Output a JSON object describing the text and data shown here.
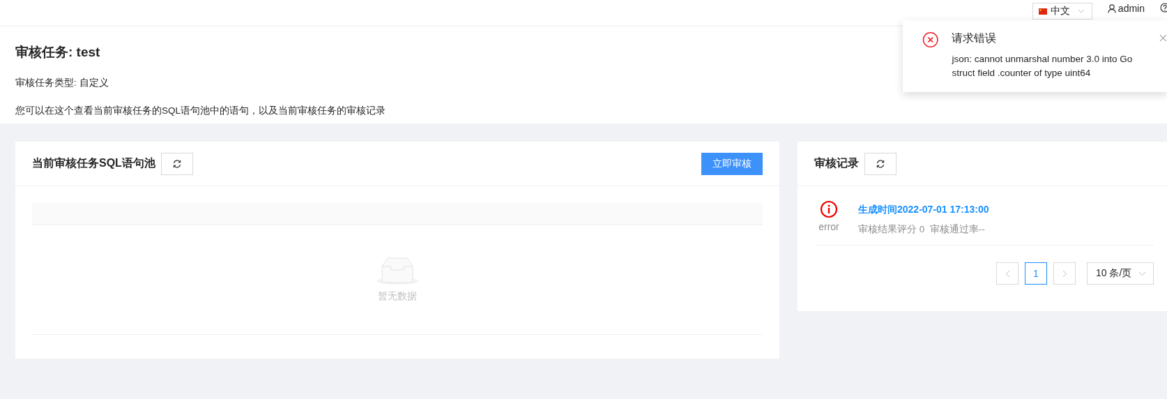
{
  "topbar": {
    "language": "中文",
    "user": "admin"
  },
  "notification": {
    "title": "请求错误",
    "message": "json: cannot unmarshal number 3.0 into Go struct field .counter of type uint64"
  },
  "header": {
    "title": "审核任务: test",
    "type_line": "审核任务类型: 自定义",
    "description": "您可以在这个查看当前审核任务的SQL语句池中的语句，以及当前审核任务的审核记录"
  },
  "sql_pool": {
    "title": "当前审核任务SQL语句池",
    "action": "立即审核",
    "empty_text": "暂无数据"
  },
  "records": {
    "title": "审核记录",
    "items": [
      {
        "status": "error",
        "time": "生成时间2022-07-01 17:13:00",
        "summary": "审核结果评分 0  审核通过率--"
      }
    ],
    "pagination": {
      "pages": [
        {
          "label": "1",
          "selected": true
        }
      ],
      "page_size": "10 条/页"
    }
  }
}
